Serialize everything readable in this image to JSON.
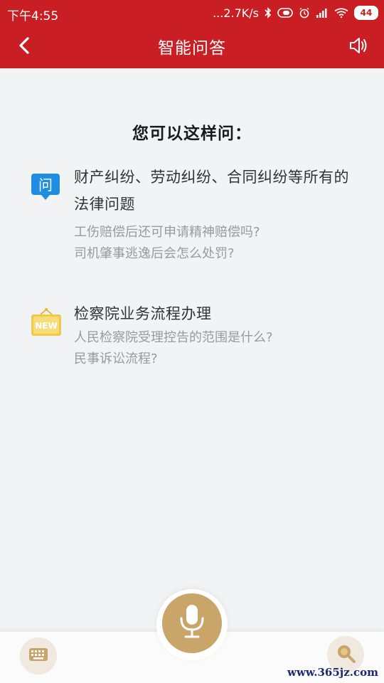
{
  "status_bar": {
    "time": "下午4:55",
    "network_speed": "...2.7K/s",
    "battery_level": "44",
    "icons": [
      "bluetooth-icon",
      "vibrate-icon",
      "alarm-icon",
      "signal-icon",
      "wifi-icon",
      "battery-icon"
    ]
  },
  "nav": {
    "title": "智能问答",
    "back_icon": "chevron-left-icon",
    "speaker_icon": "speaker-icon"
  },
  "main": {
    "heading": "您可以这样问：",
    "sections": [
      {
        "icon": "question-badge-icon",
        "icon_label": "问",
        "title": "财产纠纷、劳动纠纷、合同纠纷等所有的法律问题",
        "examples": [
          "工伤赔偿后还可申请精神赔偿吗?",
          "司机肇事逃逸后会怎么处罚?"
        ]
      },
      {
        "icon": "new-sign-icon",
        "icon_label": "NEW",
        "title": "检察院业务流程办理",
        "examples": [
          "人民检察院受理控告的范围是什么?",
          "民事诉讼流程?"
        ]
      }
    ]
  },
  "bottom_bar": {
    "keyboard_icon": "keyboard-icon",
    "mic_icon": "microphone-icon",
    "search_icon": "search-icon"
  },
  "watermark": "www.365jz.com",
  "colors": {
    "header_red": "#c81e24",
    "accent_gold": "#c9a56a",
    "badge_blue": "#1f8ee0",
    "badge_yellow": "#f0c94a"
  }
}
